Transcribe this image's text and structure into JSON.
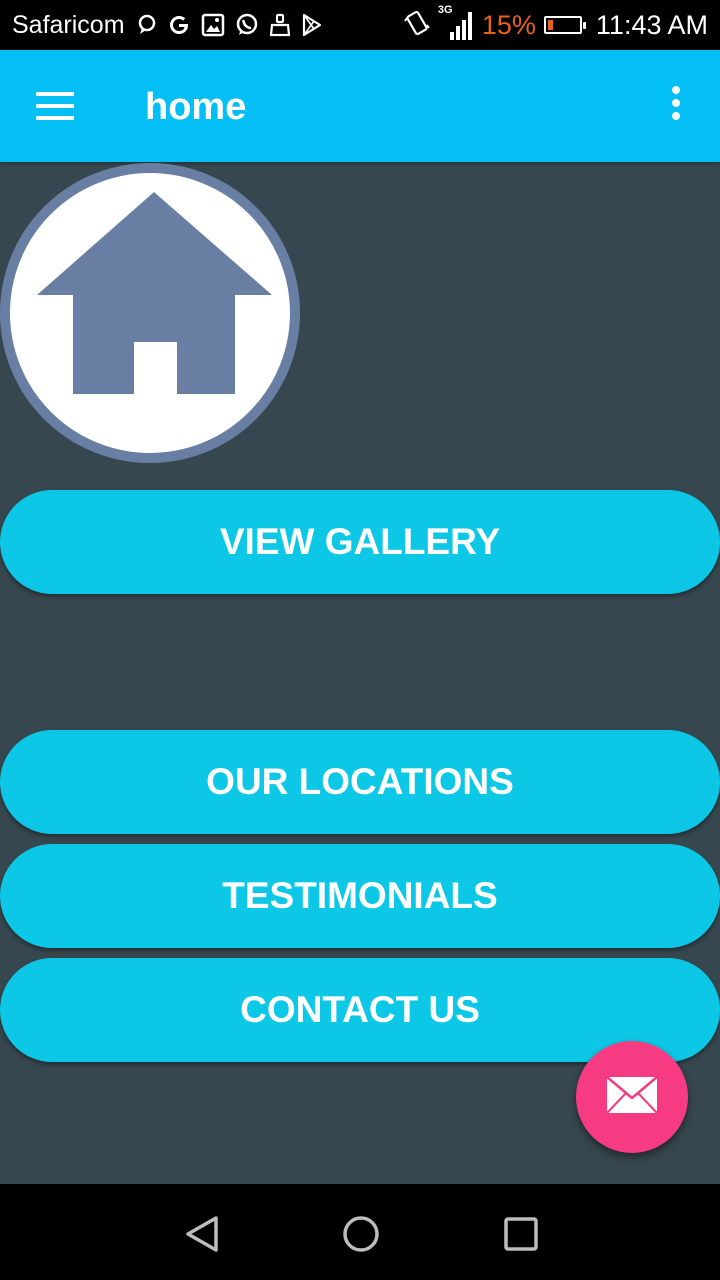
{
  "status_bar": {
    "carrier": "Safaricom",
    "network": "3G",
    "battery_percent": "15%",
    "time": "11:43 AM",
    "accent_color": "#e8621c",
    "notification_icons": [
      "chat-bubble-icon",
      "google-icon",
      "image-icon",
      "whatsapp-icon",
      "cleaner-icon",
      "play-store-icon"
    ],
    "right_icons": [
      "vibrate-icon",
      "signal-icon",
      "battery-icon"
    ]
  },
  "app_bar": {
    "title": "home",
    "color": "#03bff6",
    "menu_icon": "hamburger-menu-icon",
    "overflow_icon": "more-vert-icon"
  },
  "logo": {
    "icon": "house-icon",
    "color": "#687fa3"
  },
  "buttons": {
    "view_gallery": "VIEW GALLERY",
    "our_locations": "OUR LOCATIONS",
    "testimonials": "TESTIMONIALS",
    "contact_us": "CONTACT US",
    "color": "#0cc8e6"
  },
  "fab": {
    "icon": "mail-icon",
    "color": "#f73b83"
  },
  "nav_bar": {
    "icons": [
      "back-icon",
      "home-icon",
      "recents-icon"
    ]
  }
}
